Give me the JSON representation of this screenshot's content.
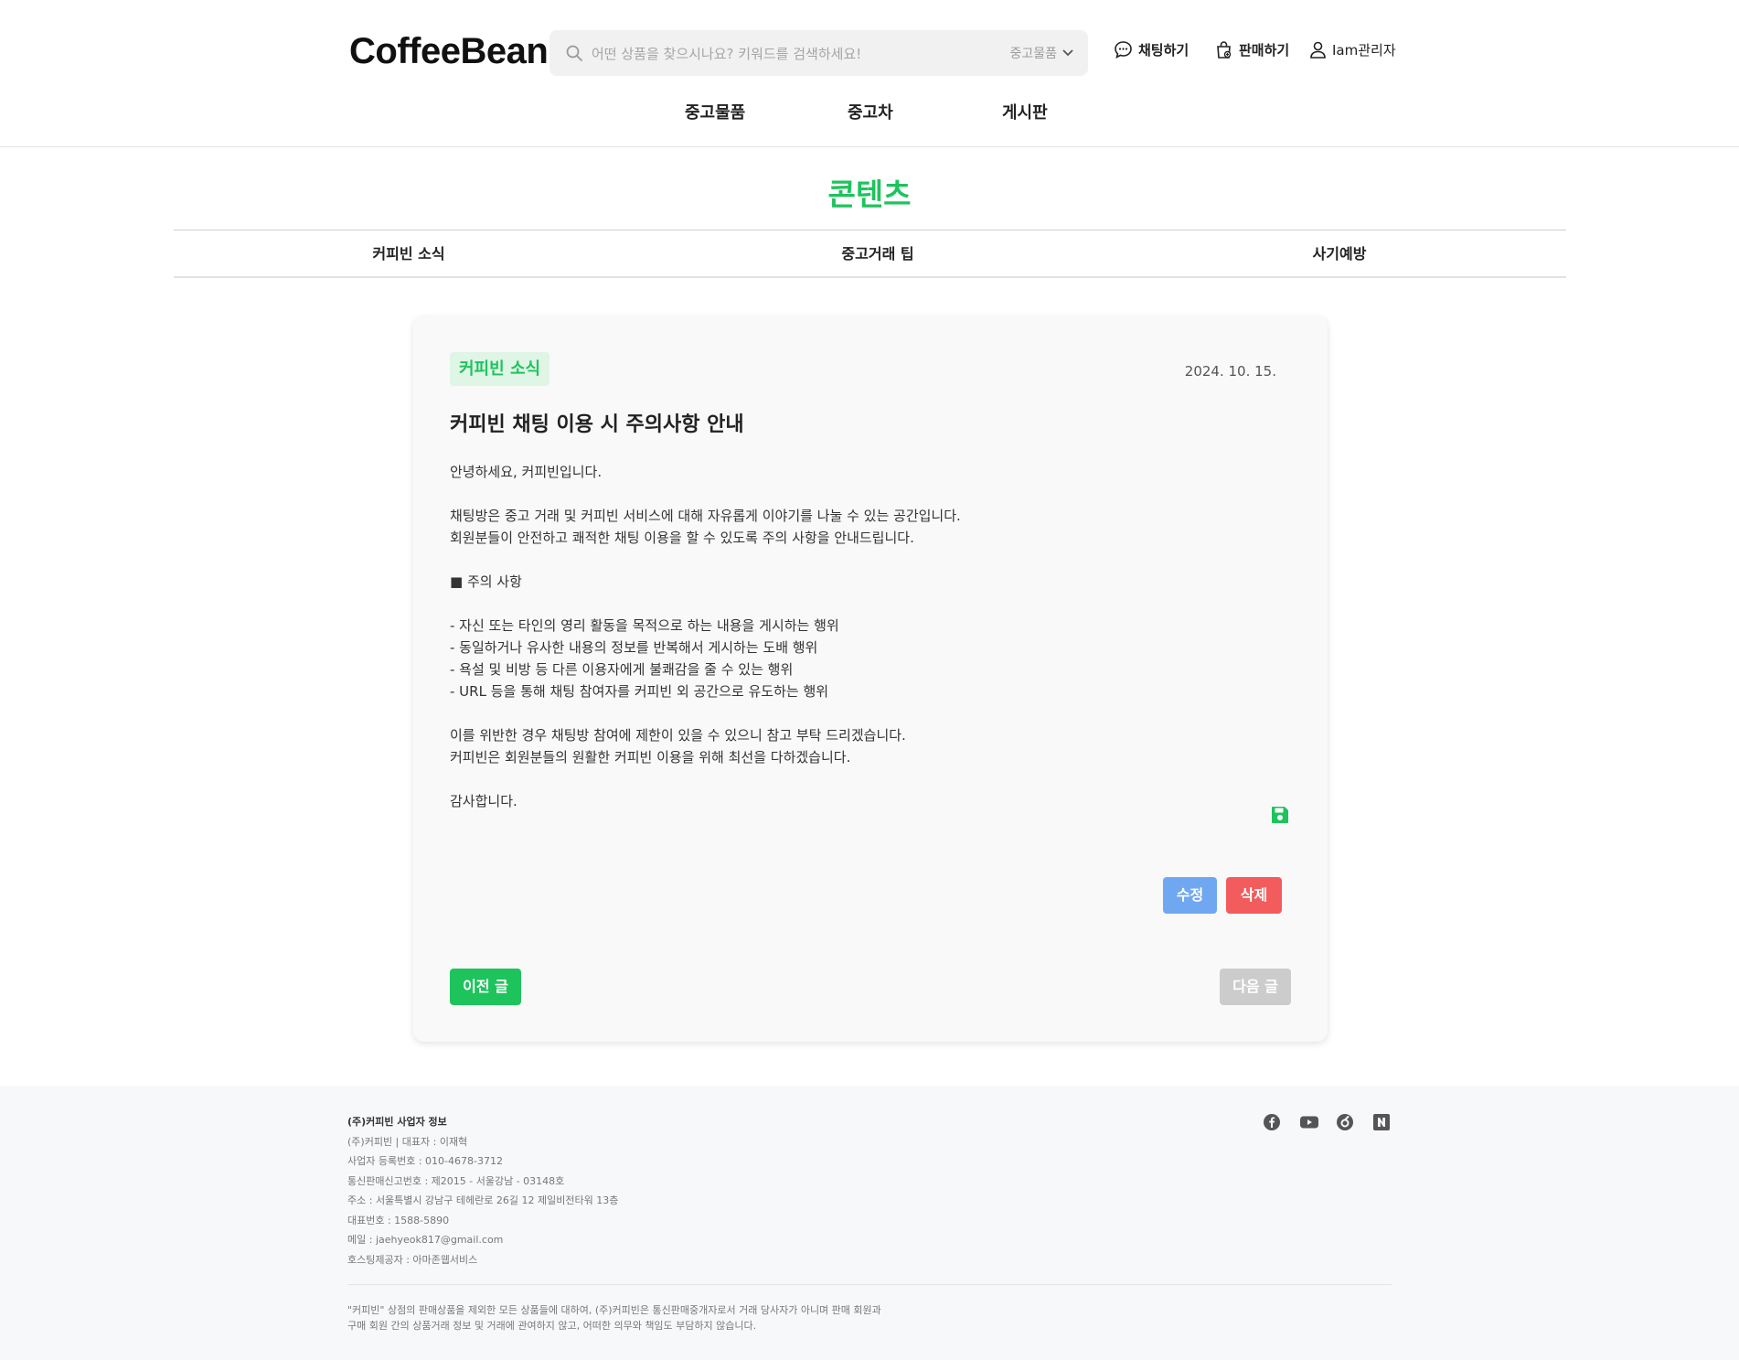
{
  "header": {
    "logo": "CoffeeBean",
    "search": {
      "placeholder": "어떤 상품을 찾으시나요? 키워드를 검색하세요!",
      "category": "중고물품"
    },
    "links": {
      "chat": "채팅하기",
      "sell": "판매하기",
      "user": "Iam관리자"
    },
    "nav": [
      "중고물품",
      "중고차",
      "게시판"
    ]
  },
  "section": {
    "title": "콘텐츠",
    "tabs": [
      "커피빈 소식",
      "중고거래 팁",
      "사기예방"
    ]
  },
  "post": {
    "category": "커피빈 소식",
    "date": "2024. 10. 15.",
    "title": "커피빈 채팅 이용 시 주의사항 안내",
    "body": [
      "안녕하세요, 커피빈입니다.",
      "",
      "채팅방은 중고 거래 및 커피빈 서비스에 대해 자유롭게 이야기를 나눌 수 있는 공간입니다.",
      "회원분들이 안전하고 쾌적한 채팅 이용을 할 수 있도록 주의 사항을 안내드립니다.",
      "",
      "■ 주의 사항",
      "",
      "- 자신 또는 타인의 영리 활동을 목적으로 하는 내용을 게시하는 행위",
      "- 동일하거나 유사한 내용의 정보를 반복해서 게시하는 도배 행위",
      "- 욕설 및 비방 등 다른 이용자에게 불쾌감을 줄 수 있는 행위",
      "- URL 등을 통해 채팅 참여자를 커피빈 외 공간으로 유도하는 행위",
      "",
      "이를 위반한 경우 채팅방 참여에 제한이 있을 수 있으니 참고 부탁 드리겠습니다.",
      "커피빈은 회원분들의 원활한 커피빈 이용을 위해 최선을 다하겠습니다.",
      "",
      "감사합니다."
    ],
    "buttons": {
      "edit": "수정",
      "delete": "삭제",
      "prev": "이전 글",
      "next": "다음 글"
    }
  },
  "footer": {
    "heading": "(주)커피빈 사업자 정보",
    "info": [
      "(주)커피빈 | 대표자 : 이재혁",
      "사업자 등록번호 : 010-4678-3712",
      "통신판매신고번호 : 제2015 - 서울강남 - 03148호",
      "주소 : 서울특별시 강남구 테헤란로 26길 12 제일비전타워 13층",
      "대표번호 : 1588-5890",
      "메일 : jaehyeok817@gmail.com",
      "호스팅제공자 : 아마존웹서비스"
    ],
    "disclaimer": [
      "\"커피빈\" 상점의 판매상품을 제외한 모든 상품들에 대하여, (주)커피빈은 통신판매중개자로서 거래 당사자가 아니며 판매 회원과",
      "구매 회원 간의 상품거래 정보 및 거래에 관여하지 않고, 어떠한 의무와 책임도 부담하지 않습니다."
    ],
    "socials": [
      "facebook-icon",
      "youtube-icon",
      "blog-icon",
      "naver-icon"
    ]
  },
  "colors": {
    "brand": "#1ec35c",
    "edit": "#6fa8f0",
    "delete": "#f25c5c",
    "disabled": "#cccccc"
  }
}
